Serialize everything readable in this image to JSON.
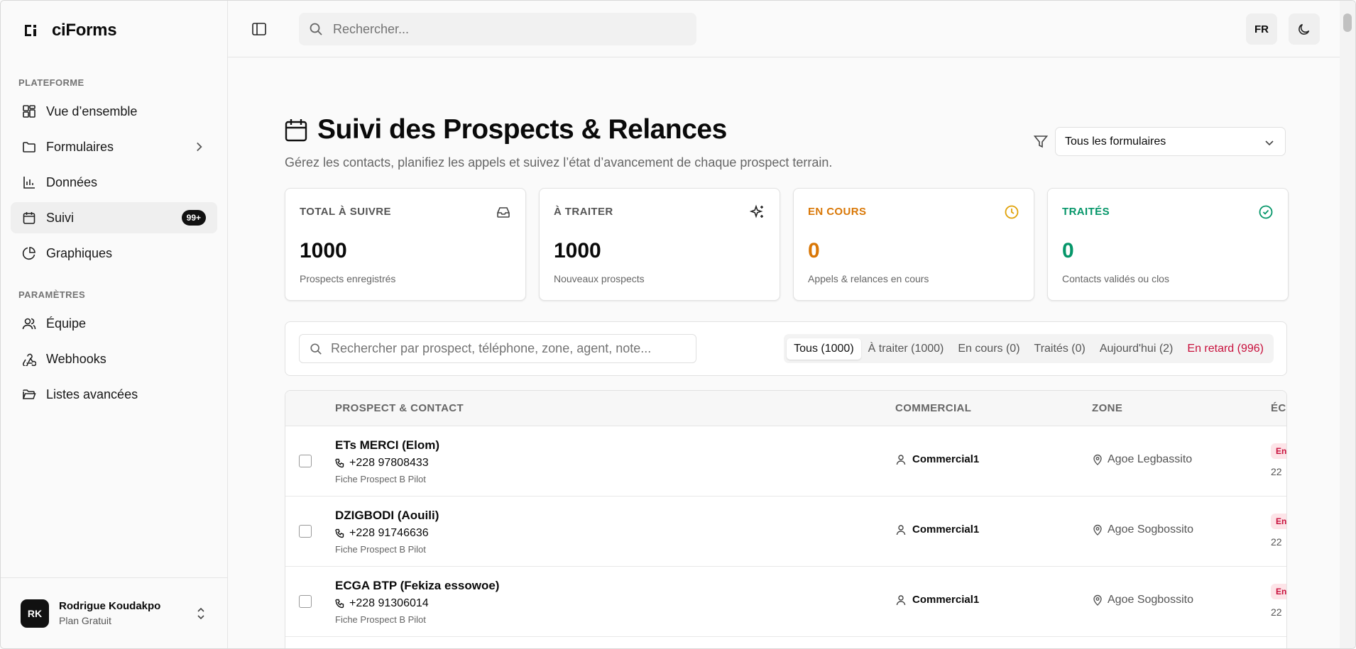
{
  "app": {
    "brand": "ciForms"
  },
  "sidebar": {
    "section_platform": "PLATEFORME",
    "section_settings": "PARAMÈTRES",
    "items": [
      {
        "label": "Vue d’ensemble",
        "icon": "dashboard-icon"
      },
      {
        "label": "Formulaires",
        "icon": "folder-icon"
      },
      {
        "label": "Données",
        "icon": "bar-chart-icon"
      },
      {
        "label": "Suivi",
        "icon": "calendar-icon",
        "badge": "99+"
      },
      {
        "label": "Graphiques",
        "icon": "pie-chart-icon"
      }
    ],
    "settings_items": [
      {
        "label": "Équipe",
        "icon": "users-icon"
      },
      {
        "label": "Webhooks",
        "icon": "webhook-icon"
      },
      {
        "label": "Listes avancées",
        "icon": "folder-open-icon"
      }
    ],
    "user": {
      "initials": "RK",
      "name": "Rodrigue Koudakpo",
      "plan": "Plan Gratuit"
    }
  },
  "topbar": {
    "search_placeholder": "Rechercher...",
    "lang": "FR"
  },
  "page": {
    "title": "Suivi des Prospects & Relances",
    "subtitle": "Gérez les contacts, planifiez les appels et suivez l’état d’avancement de chaque prospect terrain.",
    "form_filter": "Tous les formulaires"
  },
  "stats": [
    {
      "label": "TOTAL À SUIVRE",
      "value": "1000",
      "caption": "Prospects enregistrés",
      "icon": "inbox-icon"
    },
    {
      "label": "À TRAITER",
      "value": "1000",
      "caption": "Nouveaux prospects",
      "icon": "sparkles-icon"
    },
    {
      "label": "EN COURS",
      "value": "0",
      "caption": "Appels & relances en cours",
      "icon": "clock-icon",
      "color": "#d97706"
    },
    {
      "label": "TRAITÉS",
      "value": "0",
      "caption": "Contacts validés ou clos",
      "icon": "check-circle-icon",
      "color": "#059669"
    }
  ],
  "list": {
    "search_placeholder": "Rechercher par prospect, téléphone, zone, agent, note...",
    "tabs": [
      "Tous (1000)",
      "À traiter (1000)",
      "En cours (0)",
      "Traités (0)",
      "Aujourd'hui (2)",
      "En retard (996)"
    ],
    "columns": [
      "PROSPECT & CONTACT",
      "COMMERCIAL",
      "ZONE",
      "ÉC"
    ],
    "rows": [
      {
        "name": "ETs MERCI (Elom)",
        "phone": "+228 97808433",
        "form": "Fiche Prospect B Pilot",
        "commercial": "Commercial1",
        "zone": "Agoe Legbassito",
        "status": "En",
        "date": "22"
      },
      {
        "name": "DZIGBODI (Aouili)",
        "phone": "+228 91746636",
        "form": "Fiche Prospect B Pilot",
        "commercial": "Commercial1",
        "zone": "Agoe Sogbossito",
        "status": "En",
        "date": "22"
      },
      {
        "name": "ECGA BTP (Fekiza essowoe)",
        "phone": "+228 91306014",
        "form": "Fiche Prospect B Pilot",
        "commercial": "Commercial1",
        "zone": "Agoe Sogbossito",
        "status": "En",
        "date": "22"
      }
    ]
  }
}
